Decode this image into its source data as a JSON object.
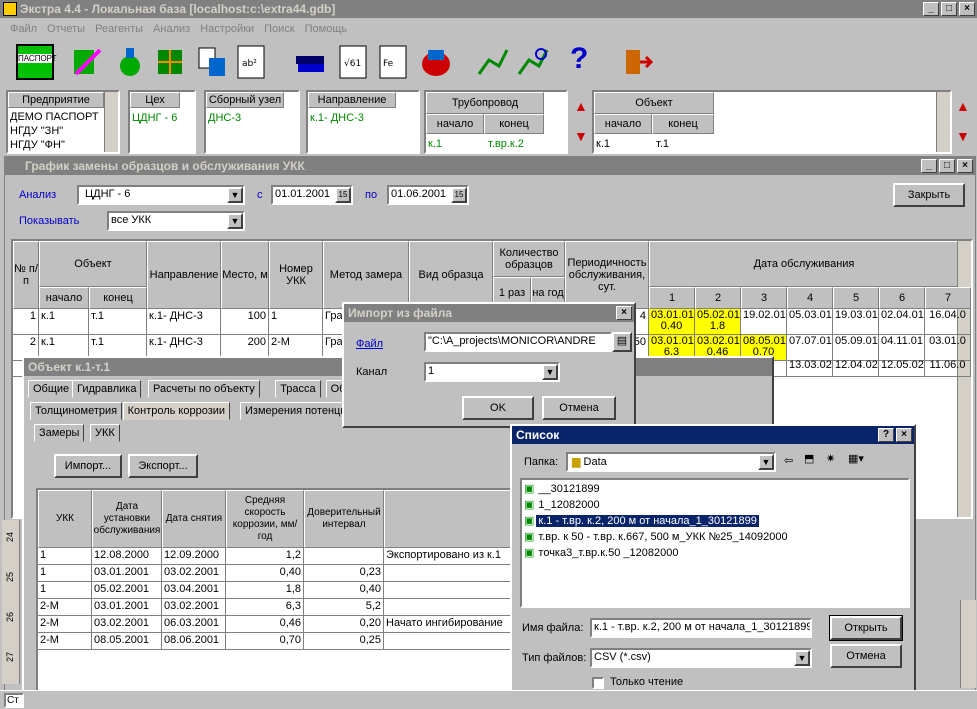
{
  "app": {
    "title": "Экстра 4.4 - Локальная база [localhost:c:\\extra44.gdb]",
    "menu": [
      "Файл",
      "Отчеты",
      "Реагенты",
      "Анализ",
      "Настройки",
      "Поиск",
      "Помощь"
    ]
  },
  "colors": {
    "title_active": "#0a246a",
    "highlight_yellow": "#ffff00",
    "link_blue": "#0000cc"
  },
  "toolbar": {
    "passport_label": "ПАСПОРТ",
    "icons": [
      "passport-icon",
      "pipe-edit-icon",
      "flask-icon",
      "circuit-icon",
      "export-icon",
      "formula-icon",
      "books-icon",
      "calc-icon",
      "chemistry-icon",
      "disk-icon",
      "network-icon",
      "network-search-icon",
      "help-icon",
      "exit-icon"
    ]
  },
  "filters": {
    "enterprise": {
      "header": "Предприятие",
      "items": [
        "ДЕМО ПАСПОРТ",
        "НГДУ \"ЗН\"",
        "НГДУ \"ФН\""
      ]
    },
    "shop": {
      "header": "Цех",
      "value": "ЦДНГ - 6"
    },
    "node": {
      "header": "Сборный узел",
      "value": "ДНС-3"
    },
    "direction": {
      "header": "Направление",
      "value": "к.1- ДНС-3"
    },
    "pipeline": {
      "header": "Трубопровод",
      "start_label": "начало",
      "end_label": "конец",
      "start": "к.1",
      "end": "т.вр.к.2"
    },
    "object": {
      "header": "Объект",
      "start_label": "начало",
      "end_label": "конец",
      "start": "к.1",
      "end": "т.1"
    }
  },
  "schedule": {
    "title": "График замены образцов и обслуживания УКК",
    "analysis_label": "Анализ",
    "analysis_value": "ЦДНГ - 6",
    "from_label": "с",
    "from_date": "01.01.2001",
    "to_label": "по",
    "to_date": "01.06.2001",
    "show_label": "Показывать",
    "show_value": "все УКК",
    "close_label": "Закрыть",
    "headers": {
      "num": "№ п/п",
      "object": "Объект",
      "start": "начало",
      "end": "конец",
      "direction": "Направление",
      "place": "Место, м",
      "ukk": "Номер УКК",
      "method": "Метод замера",
      "sample": "Вид образца",
      "count": "Количество образцов",
      "once": "1 раз",
      "per_year": "на год",
      "period": "Периодичность обслуживания, сут.",
      "service_date": "Дата обслуживания",
      "cols": [
        "1",
        "2",
        "3",
        "4",
        "5",
        "6",
        "7"
      ]
    },
    "rows": [
      {
        "n": "1",
        "start": "к.1",
        "end": "т.1",
        "dir": "к.1- ДНС-3",
        "place": "100",
        "ukk": "1",
        "method": "Грав",
        "period": "4",
        "dates": [
          "03.01.01",
          "05.02.01",
          "19.02.01",
          "05.03.01",
          "19.03.01",
          "02.04.01",
          "16.04.0"
        ],
        "sub": [
          "0.40",
          "1.8"
        ]
      },
      {
        "n": "2",
        "start": "к.1",
        "end": "т.1",
        "dir": "к.1- ДНС-3",
        "place": "200",
        "ukk": "2-М",
        "method": "Грав",
        "period": "50",
        "dates": [
          "03.01.01",
          "03.02.01",
          "08.05.01",
          "07.07.01",
          "05.09.01",
          "04.11.01",
          "03.01.0"
        ],
        "sub": [
          "6.3",
          "0.46",
          "0.70"
        ]
      },
      {
        "n": "",
        "start": "",
        "end": "",
        "dir": "",
        "place": "",
        "ukk": "",
        "method": "",
        "period": "2",
        "dates": [
          "",
          "",
          "",
          "13.03.02",
          "12.04.02",
          "12.05.02",
          "11.06.0"
        ],
        "sub": []
      }
    ]
  },
  "import_dialog": {
    "title": "Импорт из файла",
    "file_label": "Файл",
    "file_value": "\"C:\\A_projects\\MONICOR\\ANDRE",
    "channel_label": "Канал",
    "channel_value": "1",
    "ok": "OK",
    "cancel": "Отмена"
  },
  "object_window": {
    "title": "Объект к.1-т.1",
    "tabs": [
      "Общие",
      "Гидравлика",
      "Расчеты по объекту",
      "Трасса",
      "Обследо"
    ],
    "subtabs": [
      "Толщинометрия",
      "Контроль коррозии",
      "Измерения потенциал"
    ],
    "subtabs2": [
      "Замеры",
      "УКК"
    ],
    "import_btn": "Импорт...",
    "export_btn": "Экспорт...",
    "headers": [
      "УКК",
      "Дата установки обслуживания",
      "Дата снятия",
      "Средняя скорость коррозии, мм/год",
      "Доверительный интервал",
      "Примечания"
    ],
    "rows": [
      [
        "1",
        "12.08.2000",
        "12.09.2000",
        "1,2",
        "",
        "Экспортировано из к.1"
      ],
      [
        "1",
        "03.01.2001",
        "03.02.2001",
        "0,40",
        "0,23",
        ""
      ],
      [
        "1",
        "05.02.2001",
        "03.04.2001",
        "1,8",
        "0,40",
        ""
      ],
      [
        "2-М",
        "03.01.2001",
        "03.02.2001",
        "6,3",
        "5,2",
        ""
      ],
      [
        "2-М",
        "03.02.2001",
        "06.03.2001",
        "0,46",
        "0,20",
        "Начато ингибирование"
      ],
      [
        "2-М",
        "08.05.2001",
        "08.06.2001",
        "0,70",
        "0,25",
        ""
      ]
    ]
  },
  "list_dialog": {
    "title": "Список",
    "folder_label": "Папка:",
    "folder_value": "Data",
    "files": [
      "__30121899",
      "1_12082000",
      "к.1 - т.вр. к.2, 200 м от начала_1_30121899",
      "т.вр. к 50 - т.вр. к.667, 500 м_УКК №25_14092000",
      "точка3_т.вр.к.50 _12082000"
    ],
    "selected_index": 2,
    "filename_label": "Имя файла:",
    "filename_value": "к.1 - т.вр. к.2, 200 м от начала_1_30121899",
    "filetype_label": "Тип файлов:",
    "filetype_value": "CSV (*.csv)",
    "readonly_label": "Только чтение",
    "open": "Открыть",
    "cancel": "Отмена"
  },
  "left_ruler": [
    "24",
    "25",
    "26",
    "27"
  ],
  "status": {
    "left": "Ст"
  }
}
